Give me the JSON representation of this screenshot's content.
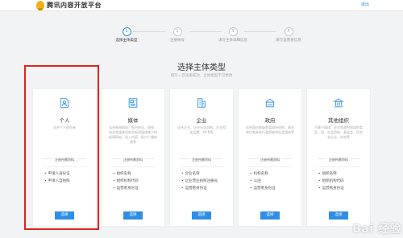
{
  "header": {
    "logo_icon": "penguin-bell-logo",
    "title": "腾讯内容开放平台",
    "exit_label": "退出"
  },
  "steps": [
    {
      "number": "1",
      "label": "选择主体类型",
      "active": true
    },
    {
      "number": "2",
      "label": "注册帐号",
      "active": false
    },
    {
      "number": "3",
      "label": "填写主体详细信息",
      "active": false
    },
    {
      "number": "4",
      "label": "填写运营者信息",
      "active": false
    }
  ],
  "main": {
    "title": "选择主体类型",
    "subtitle": "每写一旦注册成功，主体类型不可更改"
  },
  "cards": [
    {
      "icon": "person-document-icon",
      "title": "个人",
      "desc": "适合个人创作者",
      "requirements_label": "注册所需资料",
      "requirements": [
        "申请人身份证",
        "申请人自拍照"
      ],
      "button": "选择"
    },
    {
      "icon": "media-document-icon",
      "title": "媒体",
      "desc": "适合新闻网站、报刊杂志、电视、电台等媒体机构及新闻媒体旗下的新闻网站、出入内容、报户广播电视等",
      "requirements_label": "注册所需资料",
      "requirements": [
        "组织名称",
        "组织机构代码",
        "运营者身份证"
      ],
      "button": "选择"
    },
    {
      "icon": "building-icon",
      "title": "企业",
      "desc": "适合企业、企业分支机构、企业相关品牌、MCN等",
      "requirements_label": "注册所需资料",
      "requirements": [
        "企业名称",
        "企业营业执照注册号",
        "运营者身份证"
      ],
      "button": "选择"
    },
    {
      "icon": "government-icon",
      "title": "政府",
      "desc": "适合国内各级各类政府机构、事业单位和具有行政职能的社会团体等",
      "requirements_label": "注册所需资料",
      "requirements": [
        "机构名称",
        "公函",
        "运营者身份证"
      ],
      "button": "选择"
    },
    {
      "icon": "institution-icon",
      "title": "其他组织",
      "desc": "不属于媒体、企业和政府的组织类型，如：社会团体、基金会、民办非企业、协会等",
      "requirements_label": "注册所需资料",
      "requirements": [
        "组织名称",
        "组织机构代码",
        "运营者身份证"
      ],
      "button": "选择"
    }
  ],
  "watermark": "Bai 经验",
  "colors": {
    "accent": "#2f8ee6",
    "highlight": "#e2231a"
  }
}
